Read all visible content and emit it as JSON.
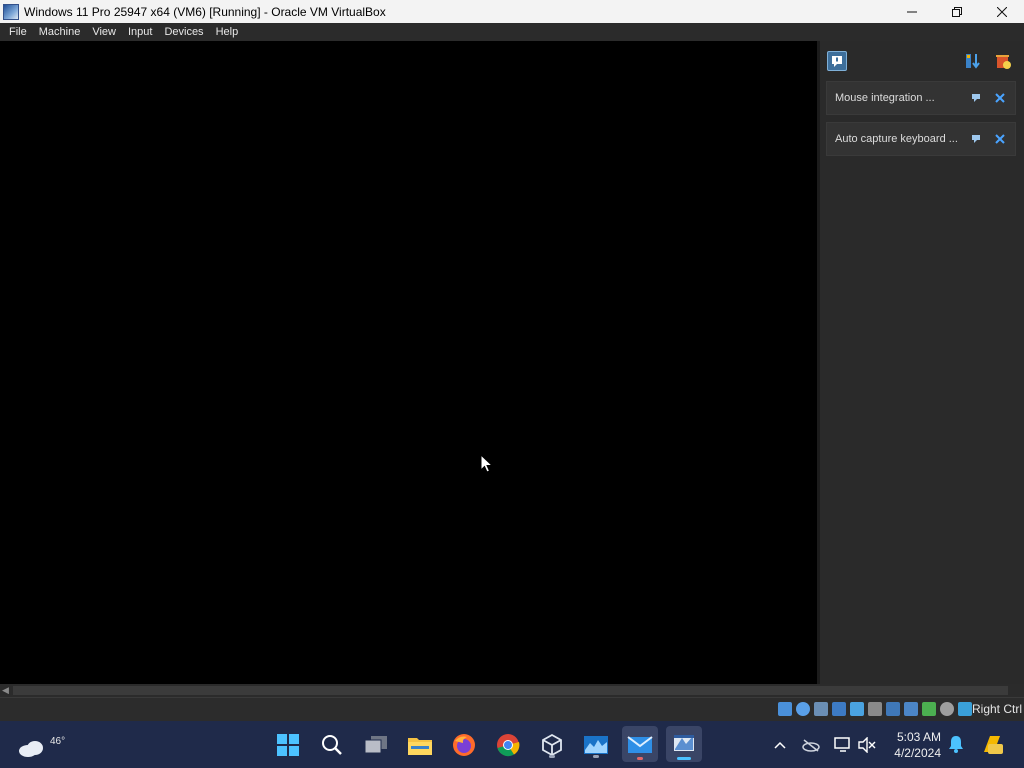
{
  "window": {
    "title": "Windows 11 Pro 25947 x64 (VM6) [Running] - Oracle VM VirtualBox",
    "controls": {
      "minimize": "—",
      "restore": "❐",
      "close": "✕"
    }
  },
  "menu": {
    "items": [
      "File",
      "Machine",
      "View",
      "Input",
      "Devices",
      "Help"
    ]
  },
  "notifications": {
    "items": [
      {
        "text": "Mouse integration ..."
      },
      {
        "text": "Auto capture keyboard ..."
      }
    ]
  },
  "statusbar": {
    "host_key": "Right Ctrl",
    "icons": [
      "hard-disk-icon",
      "optical-drive-icon",
      "audio-icon",
      "network-icon",
      "usb-icon",
      "shared-folders-icon",
      "display-icon",
      "video-capture-icon",
      "cpu-icon",
      "mouse-integration-icon",
      "keyboard-capture-icon"
    ]
  },
  "taskbar": {
    "weather_temp": "46°",
    "apps": [
      "start",
      "search",
      "task-view",
      "file-explorer",
      "firefox",
      "chrome",
      "virtualbox",
      "resource-monitor",
      "mail",
      "virtualbox-vm"
    ],
    "clock_time": "5:03 AM",
    "clock_date": "4/2/2024"
  },
  "colors": {
    "accent": "#0078d4",
    "taskbar_bg": "#1f2a4a",
    "panel_bg": "#2a2a2a"
  }
}
